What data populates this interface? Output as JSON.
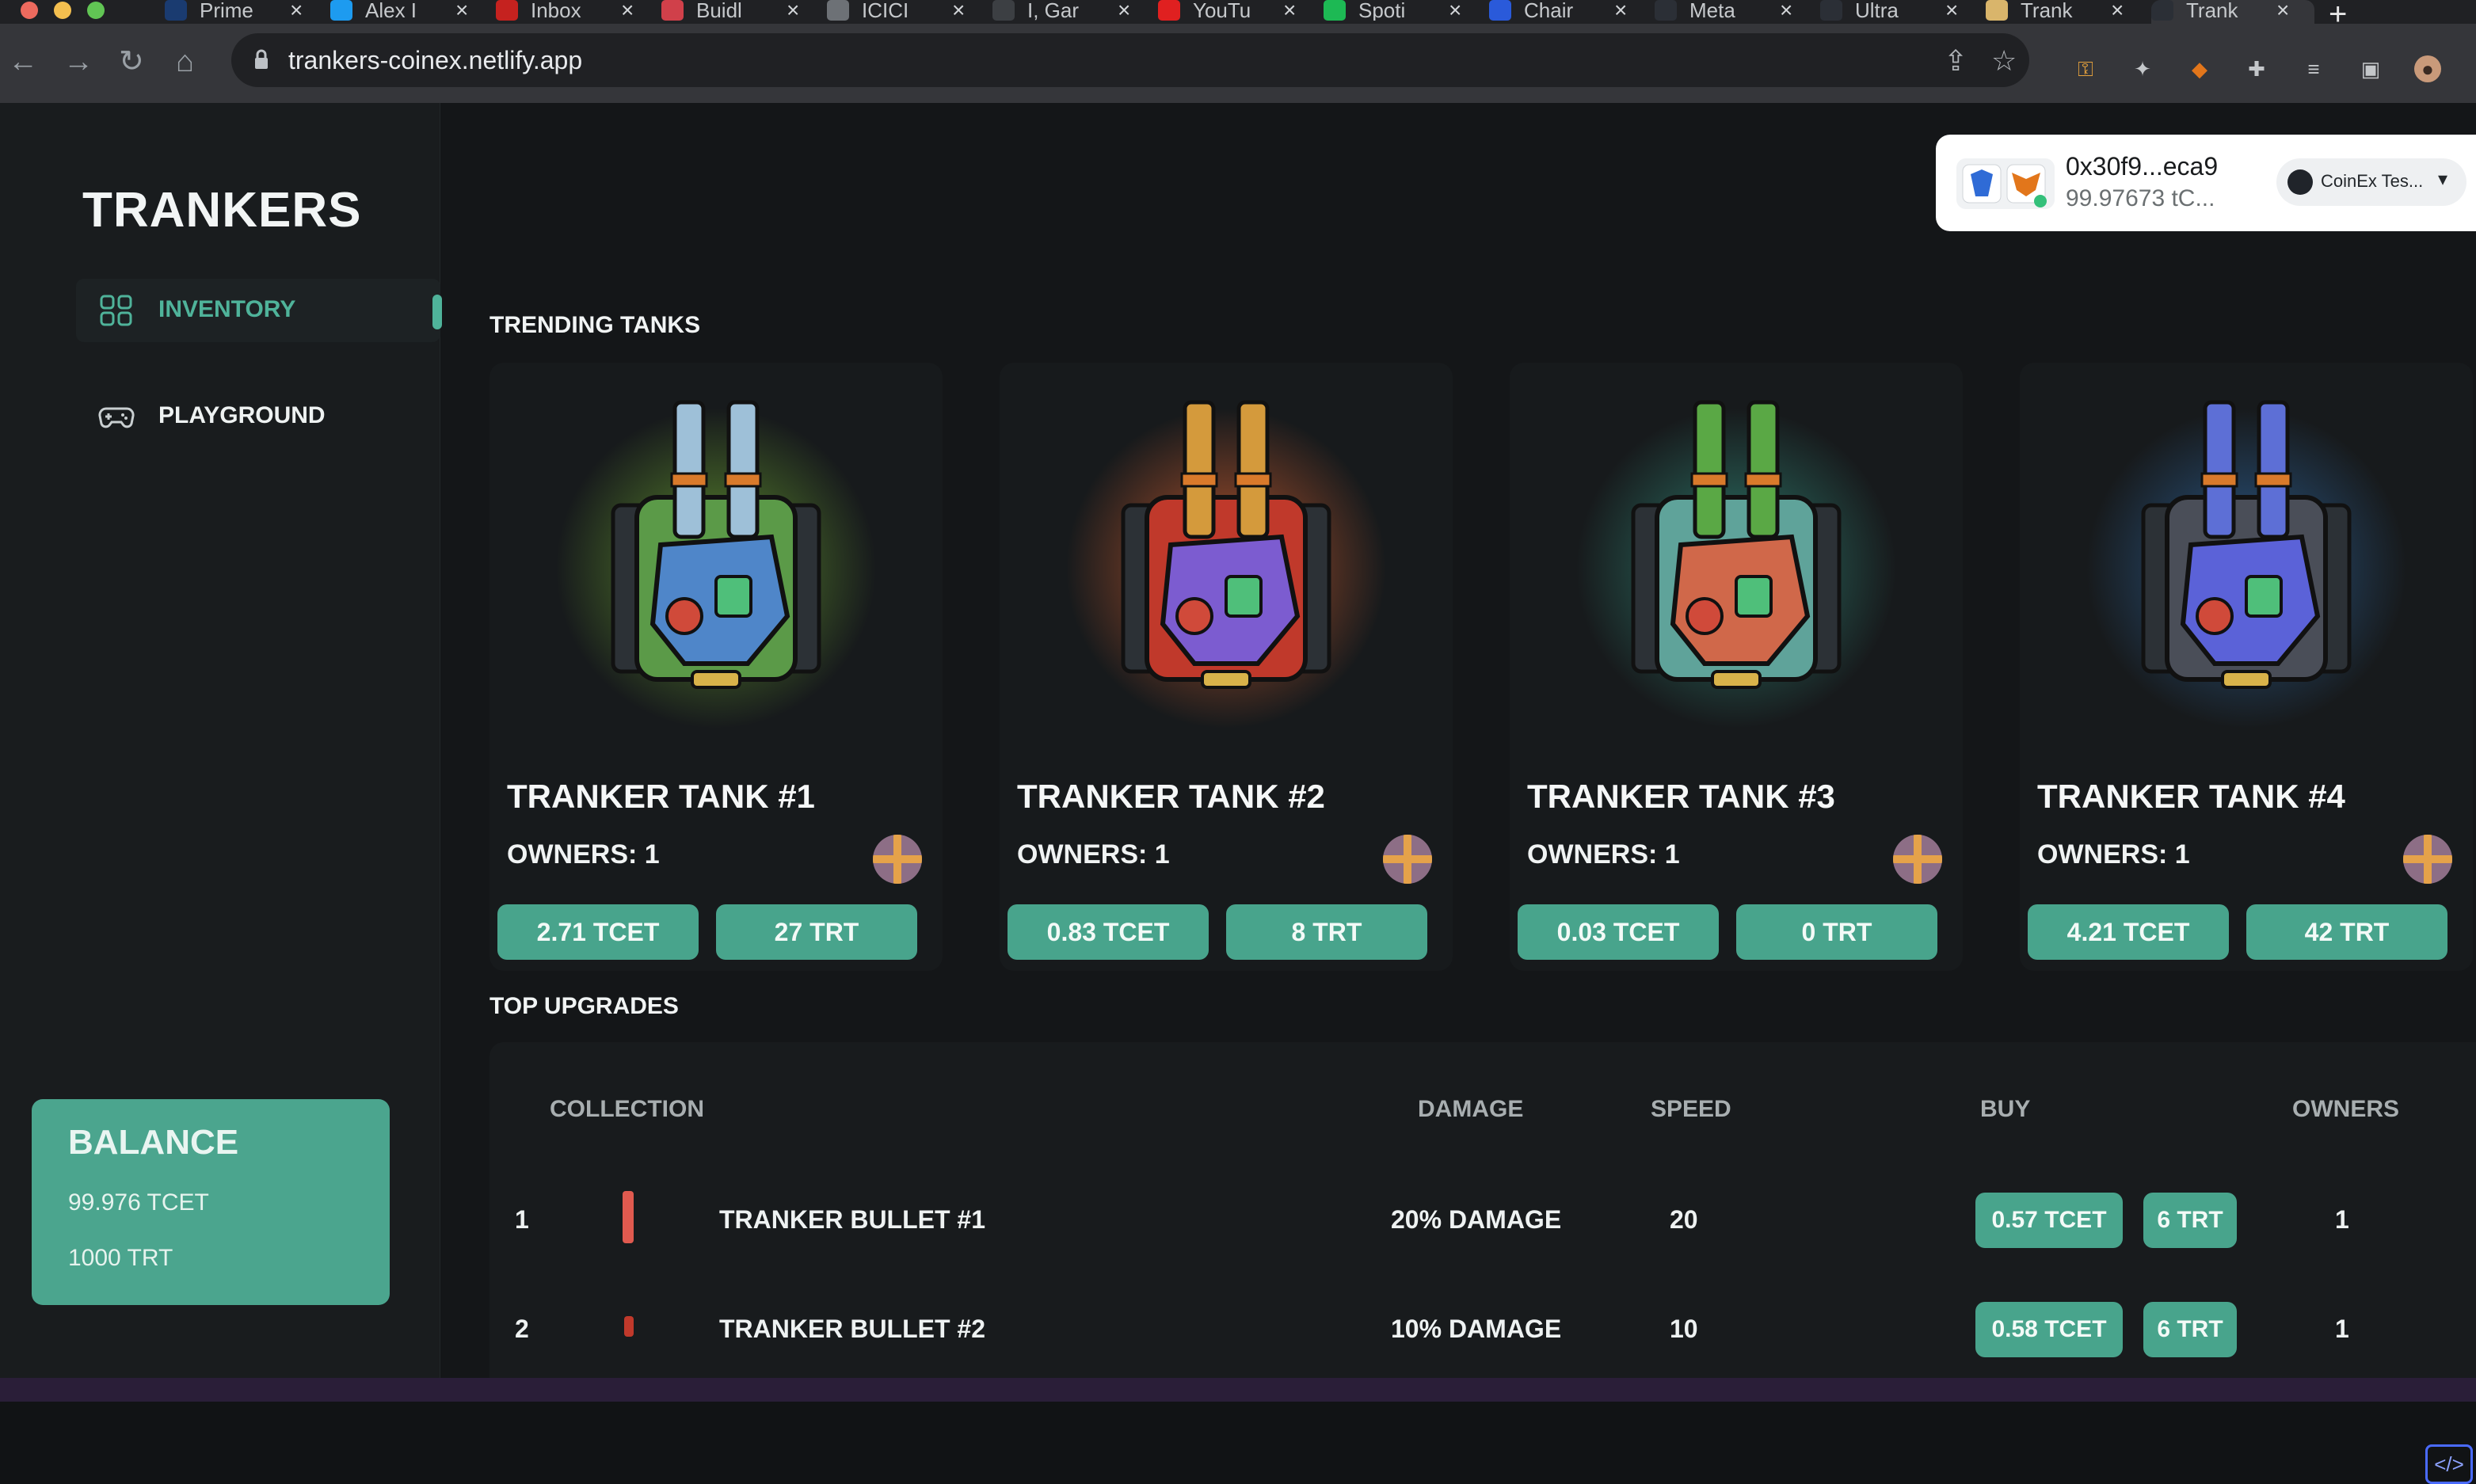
{
  "browser": {
    "tabs": [
      {
        "label": "Prime",
        "icon": "prime-video-icon",
        "color": "#1a3b70"
      },
      {
        "label": "Alex I",
        "icon": "twitter-icon",
        "color": "#1d9bf0"
      },
      {
        "label": "Inbox",
        "icon": "gmail-icon",
        "color": "#c5221f"
      },
      {
        "label": "Buidl",
        "icon": "buidl-icon",
        "color": "#d0404a"
      },
      {
        "label": "ICICI",
        "icon": "globe-icon",
        "color": "#6d7176"
      },
      {
        "label": "I, Gar",
        "icon": "g-icon",
        "color": "#3c3f43"
      },
      {
        "label": "YouTu",
        "icon": "youtube-icon",
        "color": "#e02020"
      },
      {
        "label": "Spoti",
        "icon": "spotify-icon",
        "color": "#1db954"
      },
      {
        "label": "Chair",
        "icon": "chainlink-icon",
        "color": "#2a5ada"
      },
      {
        "label": "Meta",
        "icon": "d-icon",
        "color": "#2b2f36"
      },
      {
        "label": "Ultra",
        "icon": "d-icon",
        "color": "#2b2f36"
      },
      {
        "label": "Trank",
        "icon": "folder-icon",
        "color": "#d9b56b"
      },
      {
        "label": "Trank",
        "icon": "netlify-icon",
        "color": "#2b2f36"
      }
    ],
    "url": "trankers-coinex.netlify.app"
  },
  "sidebar": {
    "brand": "TRANKERS",
    "items": [
      {
        "label": "INVENTORY",
        "icon": "grid-icon",
        "active": true
      },
      {
        "label": "PLAYGROUND",
        "icon": "gamepad-icon",
        "active": false
      }
    ],
    "balance": {
      "title": "BALANCE",
      "tcet": "99.976 TCET",
      "trt": "1000 TRT"
    }
  },
  "wallet": {
    "address": "0x30f9...eca9",
    "balance": "99.97673 tC...",
    "network": "CoinEx Tes..."
  },
  "trending": {
    "title": "TRENDING TANKS",
    "cards": [
      {
        "name": "TRANKER TANK #1",
        "owners": "OWNERS: 1",
        "price_tcet": "2.71 TCET",
        "price_trt": "27 TRT",
        "glow": "#5f8f2e",
        "body": "#5b9a48",
        "barrel": "#9ec0d8",
        "core": "#4f86c9"
      },
      {
        "name": "TRANKER TANK #2",
        "owners": "OWNERS: 1",
        "price_tcet": "0.83 TCET",
        "price_trt": "8 TRT",
        "glow": "#b8552d",
        "body": "#c0392b",
        "barrel": "#d49a3c",
        "core": "#7c5cd0"
      },
      {
        "name": "TRANKER TANK #3",
        "owners": "OWNERS: 1",
        "price_tcet": "0.03 TCET",
        "price_trt": "0 TRT",
        "glow": "#2e7a6c",
        "body": "#5fa39a",
        "barrel": "#5aa845",
        "core": "#d0684a"
      },
      {
        "name": "TRANKER TANK #4",
        "owners": "OWNERS: 1",
        "price_tcet": "4.21 TCET",
        "price_trt": "42 TRT",
        "glow": "#2b5a8a",
        "body": "#4a4e58",
        "barrel": "#5d6fd6",
        "core": "#5b62d8"
      }
    ]
  },
  "upgrades": {
    "title": "TOP UPGRADES",
    "columns": [
      "COLLECTION",
      "DAMAGE",
      "SPEED",
      "BUY",
      "OWNERS"
    ],
    "rows": [
      {
        "rank": "1",
        "name": "TRANKER BULLET #1",
        "damage": "20% DAMAGE",
        "speed": "20",
        "buy_tcet": "0.57 TCET",
        "buy_trt": "6 TRT",
        "owners": "1",
        "icon_color": "#e05a4f"
      },
      {
        "rank": "2",
        "name": "TRANKER BULLET #2",
        "damage": "10% DAMAGE",
        "speed": "10",
        "buy_tcet": "0.58 TCET",
        "buy_trt": "6 TRT",
        "owners": "1",
        "icon_color": "#c0392b"
      }
    ]
  },
  "colors": {
    "accent": "#48a48c",
    "background": "#141618",
    "sidebar": "#191c1e"
  }
}
